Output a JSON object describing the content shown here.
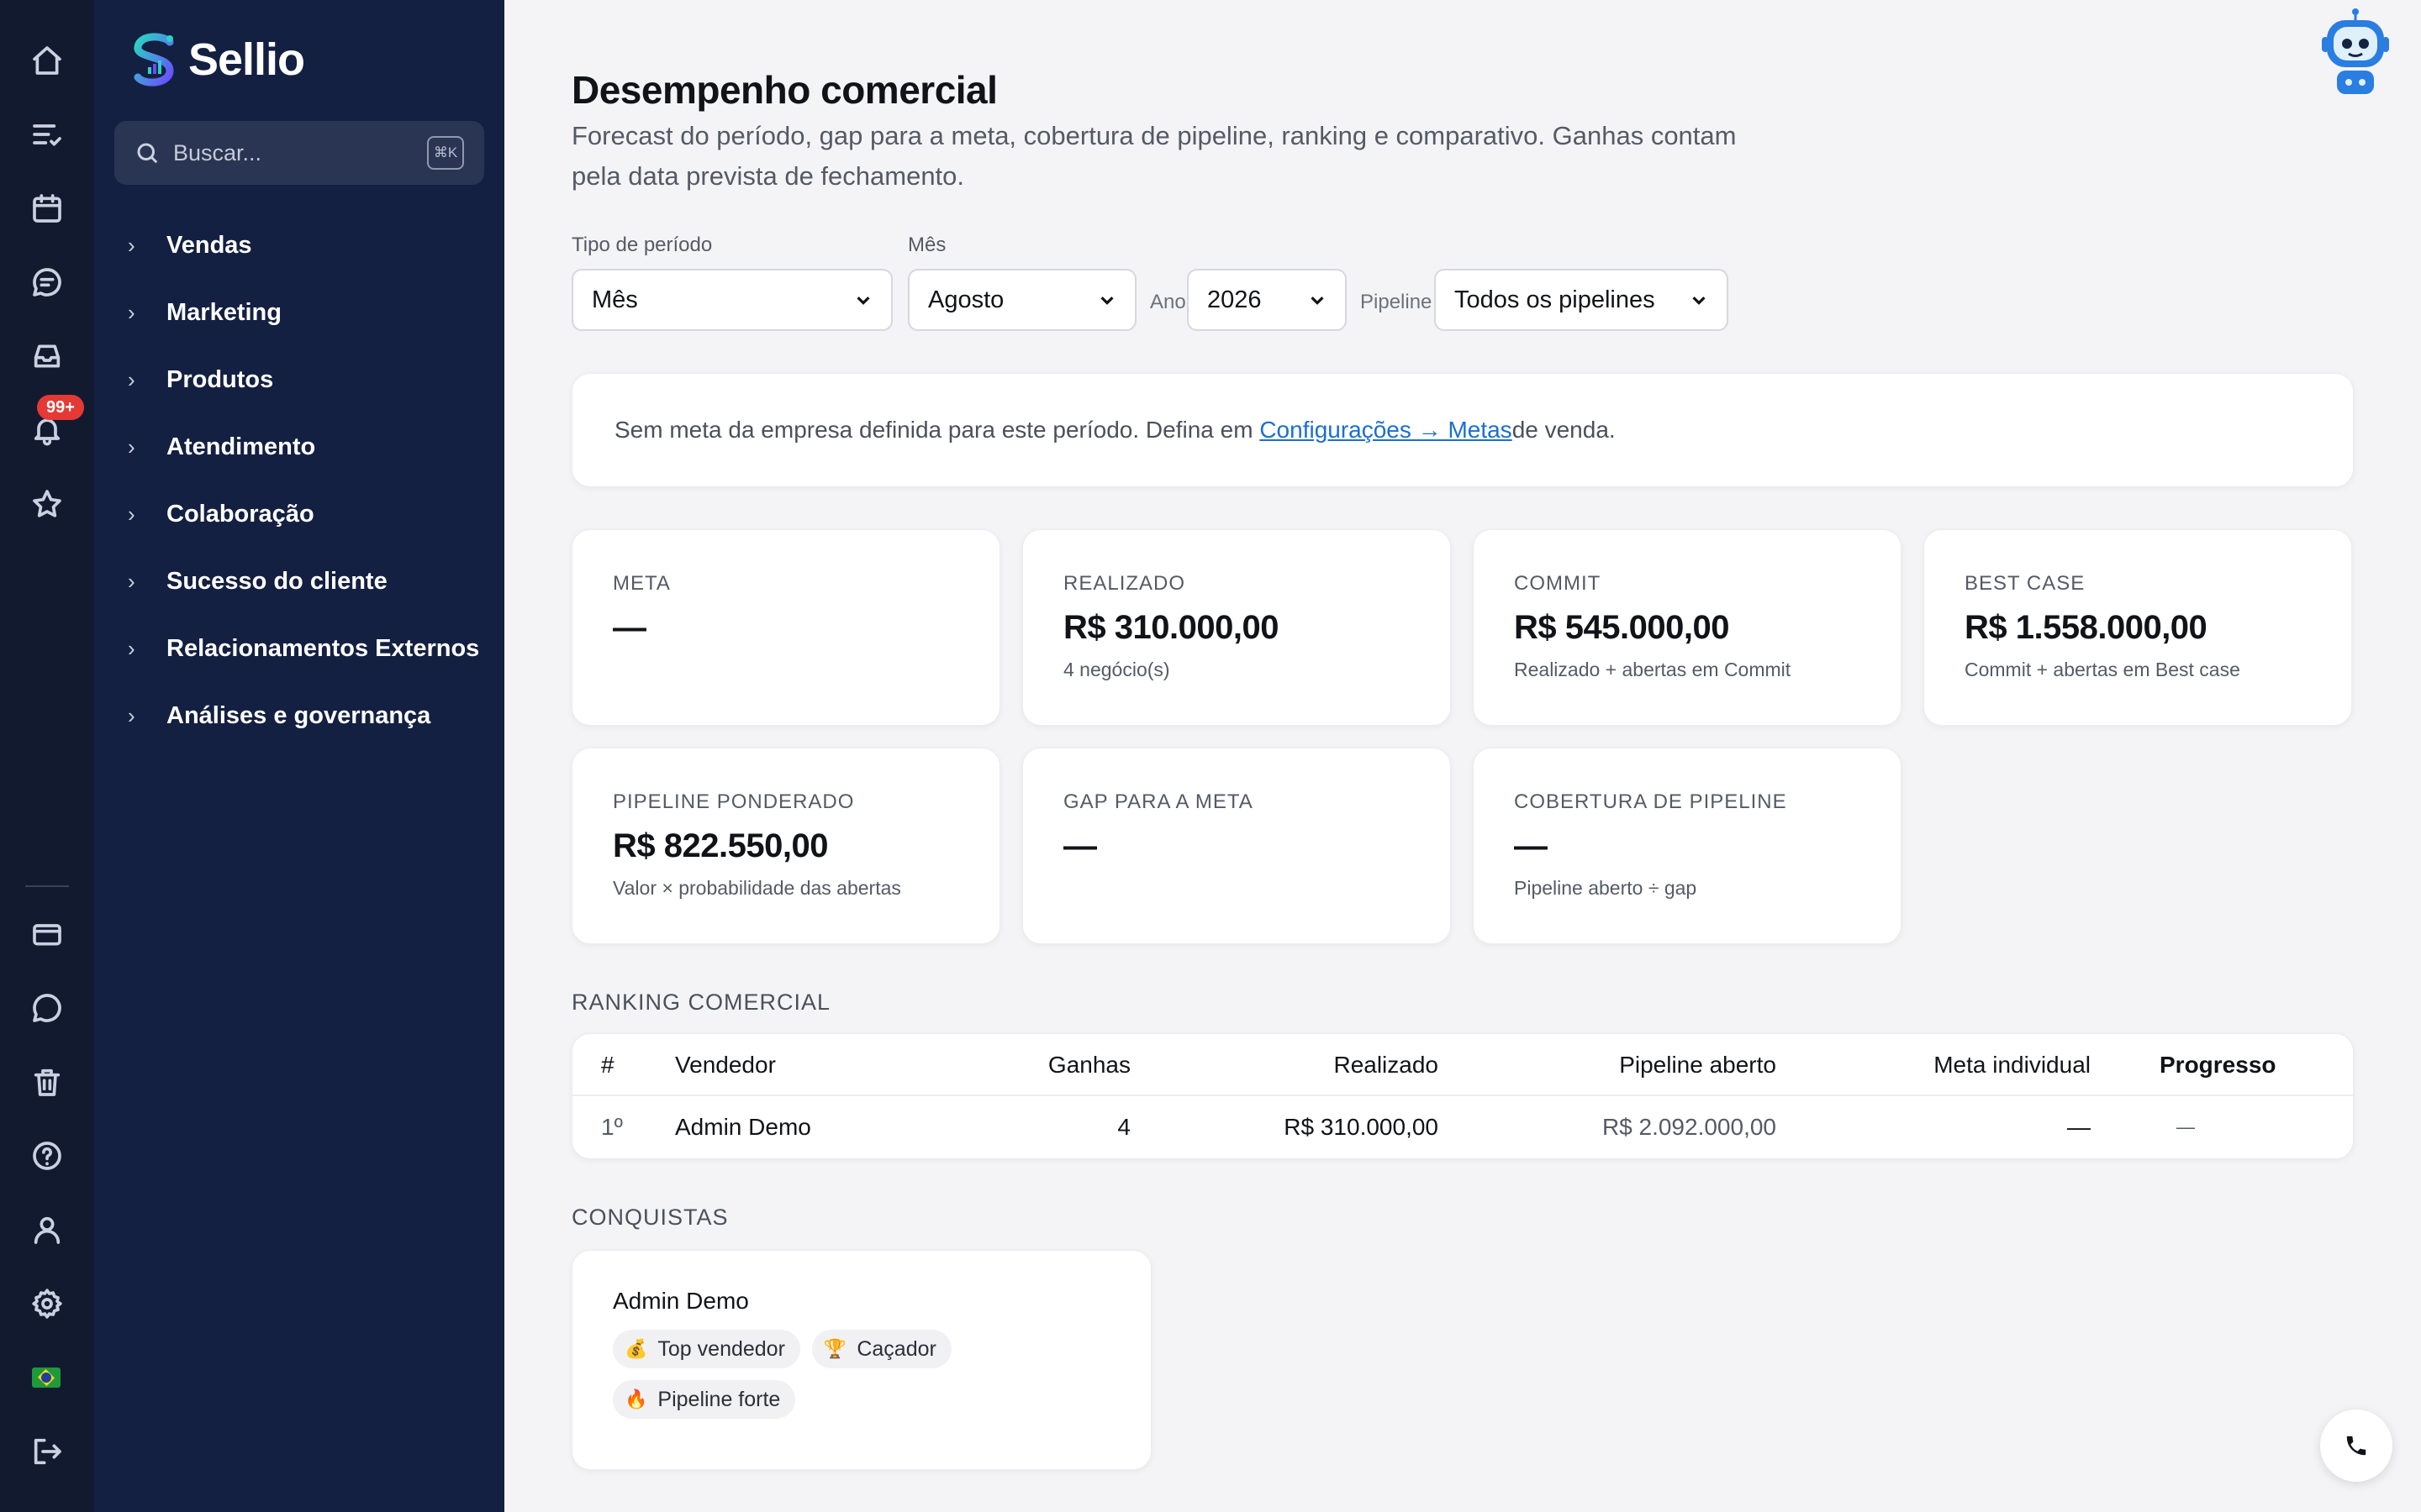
{
  "app": {
    "name": "Sellio"
  },
  "rail": {
    "notification_badge": "99+",
    "icons": [
      "home-icon",
      "tasks-icon",
      "calendar-icon",
      "chat-icon",
      "inbox-icon",
      "bell-icon",
      "star-icon",
      "card-icon",
      "message-icon",
      "trash-icon",
      "help-icon",
      "user-icon",
      "gear-icon",
      "brazil-flag-icon",
      "logout-icon"
    ]
  },
  "sidebar": {
    "search_placeholder": "Buscar...",
    "search_shortcut": "⌘K",
    "items": [
      {
        "label": "Vendas"
      },
      {
        "label": "Marketing"
      },
      {
        "label": "Produtos"
      },
      {
        "label": "Atendimento"
      },
      {
        "label": "Colaboração"
      },
      {
        "label": "Sucesso do cliente"
      },
      {
        "label": "Relacionamentos Externos"
      },
      {
        "label": "Análises e governança"
      }
    ]
  },
  "header": {
    "title": "Desempenho comercial",
    "subtitle": "Forecast do período, gap para a meta, cobertura de pipeline, ranking e comparativo. Ganhas contam pela data prevista de fechamento."
  },
  "filters": {
    "period_type_label": "Tipo de período",
    "period_type_value": "Mês",
    "month_label": "Mês",
    "month_value": "Agosto",
    "year_label": "Ano",
    "year_value": "2026",
    "pipeline_label": "Pipeline",
    "pipeline_value": "Todos os pipelines"
  },
  "notice": {
    "text_before": "Sem meta da empresa definida para este período. Defina em ",
    "link": "Configurações → Metas",
    "text_after": " de venda."
  },
  "kpis": [
    {
      "label": "META",
      "value": "—",
      "hint": ""
    },
    {
      "label": "REALIZADO",
      "value": "R$ 310.000,00",
      "hint": "4 negócio(s)"
    },
    {
      "label": "COMMIT",
      "value": "R$ 545.000,00",
      "hint": "Realizado + abertas em Commit"
    },
    {
      "label": "BEST CASE",
      "value": "R$ 1.558.000,00",
      "hint": "Commit + abertas em Best case"
    },
    {
      "label": "PIPELINE PONDERADO",
      "value": "R$ 822.550,00",
      "hint": "Valor × probabilidade das abertas"
    },
    {
      "label": "GAP PARA A META",
      "value": "—",
      "hint": ""
    },
    {
      "label": "COBERTURA DE PIPELINE",
      "value": "—",
      "hint": "Pipeline aberto ÷ gap"
    }
  ],
  "ranking": {
    "title": "RANKING COMERCIAL",
    "headers": [
      "#",
      "Vendedor",
      "Ganhas",
      "Realizado",
      "Pipeline aberto",
      "Meta individual",
      "Progresso"
    ],
    "rows": [
      [
        "1º",
        "Admin Demo",
        "4",
        "R$ 310.000,00",
        "R$ 2.092.000,00",
        "—",
        "—"
      ]
    ]
  },
  "achievements": {
    "title": "CONQUISTAS",
    "user": "Admin Demo",
    "badges": [
      {
        "emoji": "💰",
        "label": "Top vendedor"
      },
      {
        "emoji": "🏆",
        "label": "Caçador"
      },
      {
        "emoji": "🔥",
        "label": "Pipeline forte"
      }
    ]
  },
  "colors": {
    "rail_bg": "#121a30",
    "sidebar_bg": "#142041",
    "link": "#1a6fd0",
    "badge": "#e53935",
    "brand_gradient": [
      "#2bd4c4",
      "#6a4cff"
    ]
  }
}
